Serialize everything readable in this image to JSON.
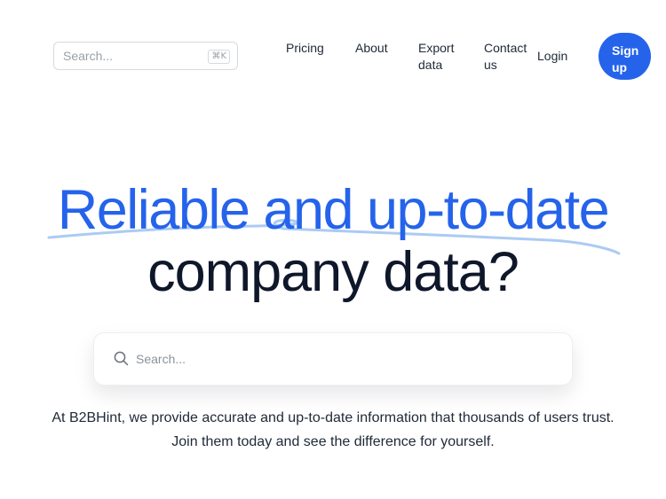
{
  "header": {
    "search": {
      "placeholder": "Search...",
      "shortcut": "⌘K"
    },
    "nav": {
      "pricing": "Pricing",
      "about": "About",
      "export_data": "Export data",
      "contact_us": "Contact us",
      "login": "Login"
    },
    "signup_label": "Sign up"
  },
  "hero": {
    "title_line1": "Reliable and up-to-date",
    "title_line2": "company data?",
    "search_placeholder": "Search...",
    "description_line1": "At B2BHint, we provide accurate and up-to-date information that thousands of users trust.",
    "description_line2": "Join them today and see the difference for yourself."
  },
  "colors": {
    "accent": "#2563eb",
    "accent_soft": "#9cc2f2",
    "heading_dark": "#0f172a"
  },
  "icons": {
    "search": "magnifying-glass-icon"
  }
}
